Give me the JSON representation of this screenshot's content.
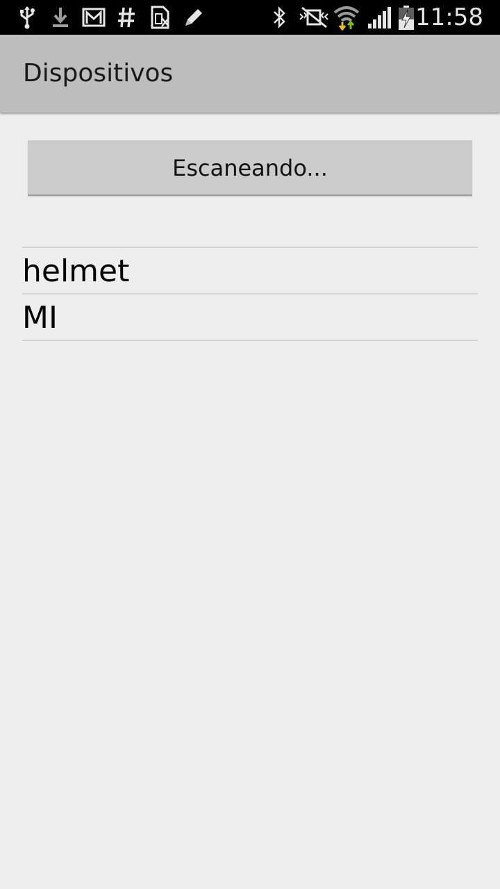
{
  "status_bar": {
    "time": "11:58",
    "left_icons": [
      "usb-icon",
      "download-icon",
      "gmail-icon",
      "hashtag-icon",
      "sim-icon",
      "pencil-icon"
    ],
    "right_icons": [
      "bluetooth-icon",
      "vibrate-mute-icon",
      "wifi-icon",
      "signal-icon",
      "battery-charging-icon"
    ],
    "wifi_arrow_colors": [
      "#f5c400",
      "#7ac200"
    ]
  },
  "action_bar": {
    "title": "Dispositivos",
    "background": "#bdbdbd"
  },
  "scan_button": {
    "label": "Escaneando..."
  },
  "devices": [
    {
      "name": "helmet"
    },
    {
      "name": "MI"
    }
  ]
}
